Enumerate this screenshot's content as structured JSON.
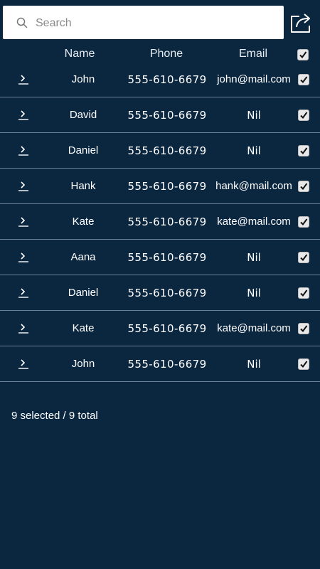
{
  "search": {
    "placeholder": "Search",
    "value": ""
  },
  "header": {
    "name": "Name",
    "phone": "Phone",
    "email": "Email",
    "select_all_checked": true
  },
  "contacts": [
    {
      "name": "John",
      "phone": "555-610-6679",
      "email": "john@mail.com",
      "checked": true
    },
    {
      "name": "David",
      "phone": "555-610-6679",
      "email": "Nil",
      "checked": true
    },
    {
      "name": "Daniel",
      "phone": "555-610-6679",
      "email": "Nil",
      "checked": true
    },
    {
      "name": "Hank",
      "phone": "555-610-6679",
      "email": "hank@mail.com",
      "checked": true
    },
    {
      "name": "Kate",
      "phone": "555-610-6679",
      "email": "kate@mail.com",
      "checked": true
    },
    {
      "name": "Aana",
      "phone": "555-610-6679",
      "email": "Nil",
      "checked": true
    },
    {
      "name": "Daniel",
      "phone": "555-610-6679",
      "email": "Nil",
      "checked": true
    },
    {
      "name": "Kate",
      "phone": "555-610-6679",
      "email": "kate@mail.com",
      "checked": true
    },
    {
      "name": "John",
      "phone": "555-610-6679",
      "email": "Nil",
      "checked": true
    }
  ],
  "status": {
    "text": "9 selected / 9 total"
  },
  "icons": {
    "search": "search-icon",
    "share": "share-icon",
    "row_expand": "chevron-right-icon",
    "checkbox": "checkbox-checked-icon"
  },
  "colors": {
    "background": "#0b2740",
    "divider": "#6b8099",
    "text": "#ffffff"
  }
}
